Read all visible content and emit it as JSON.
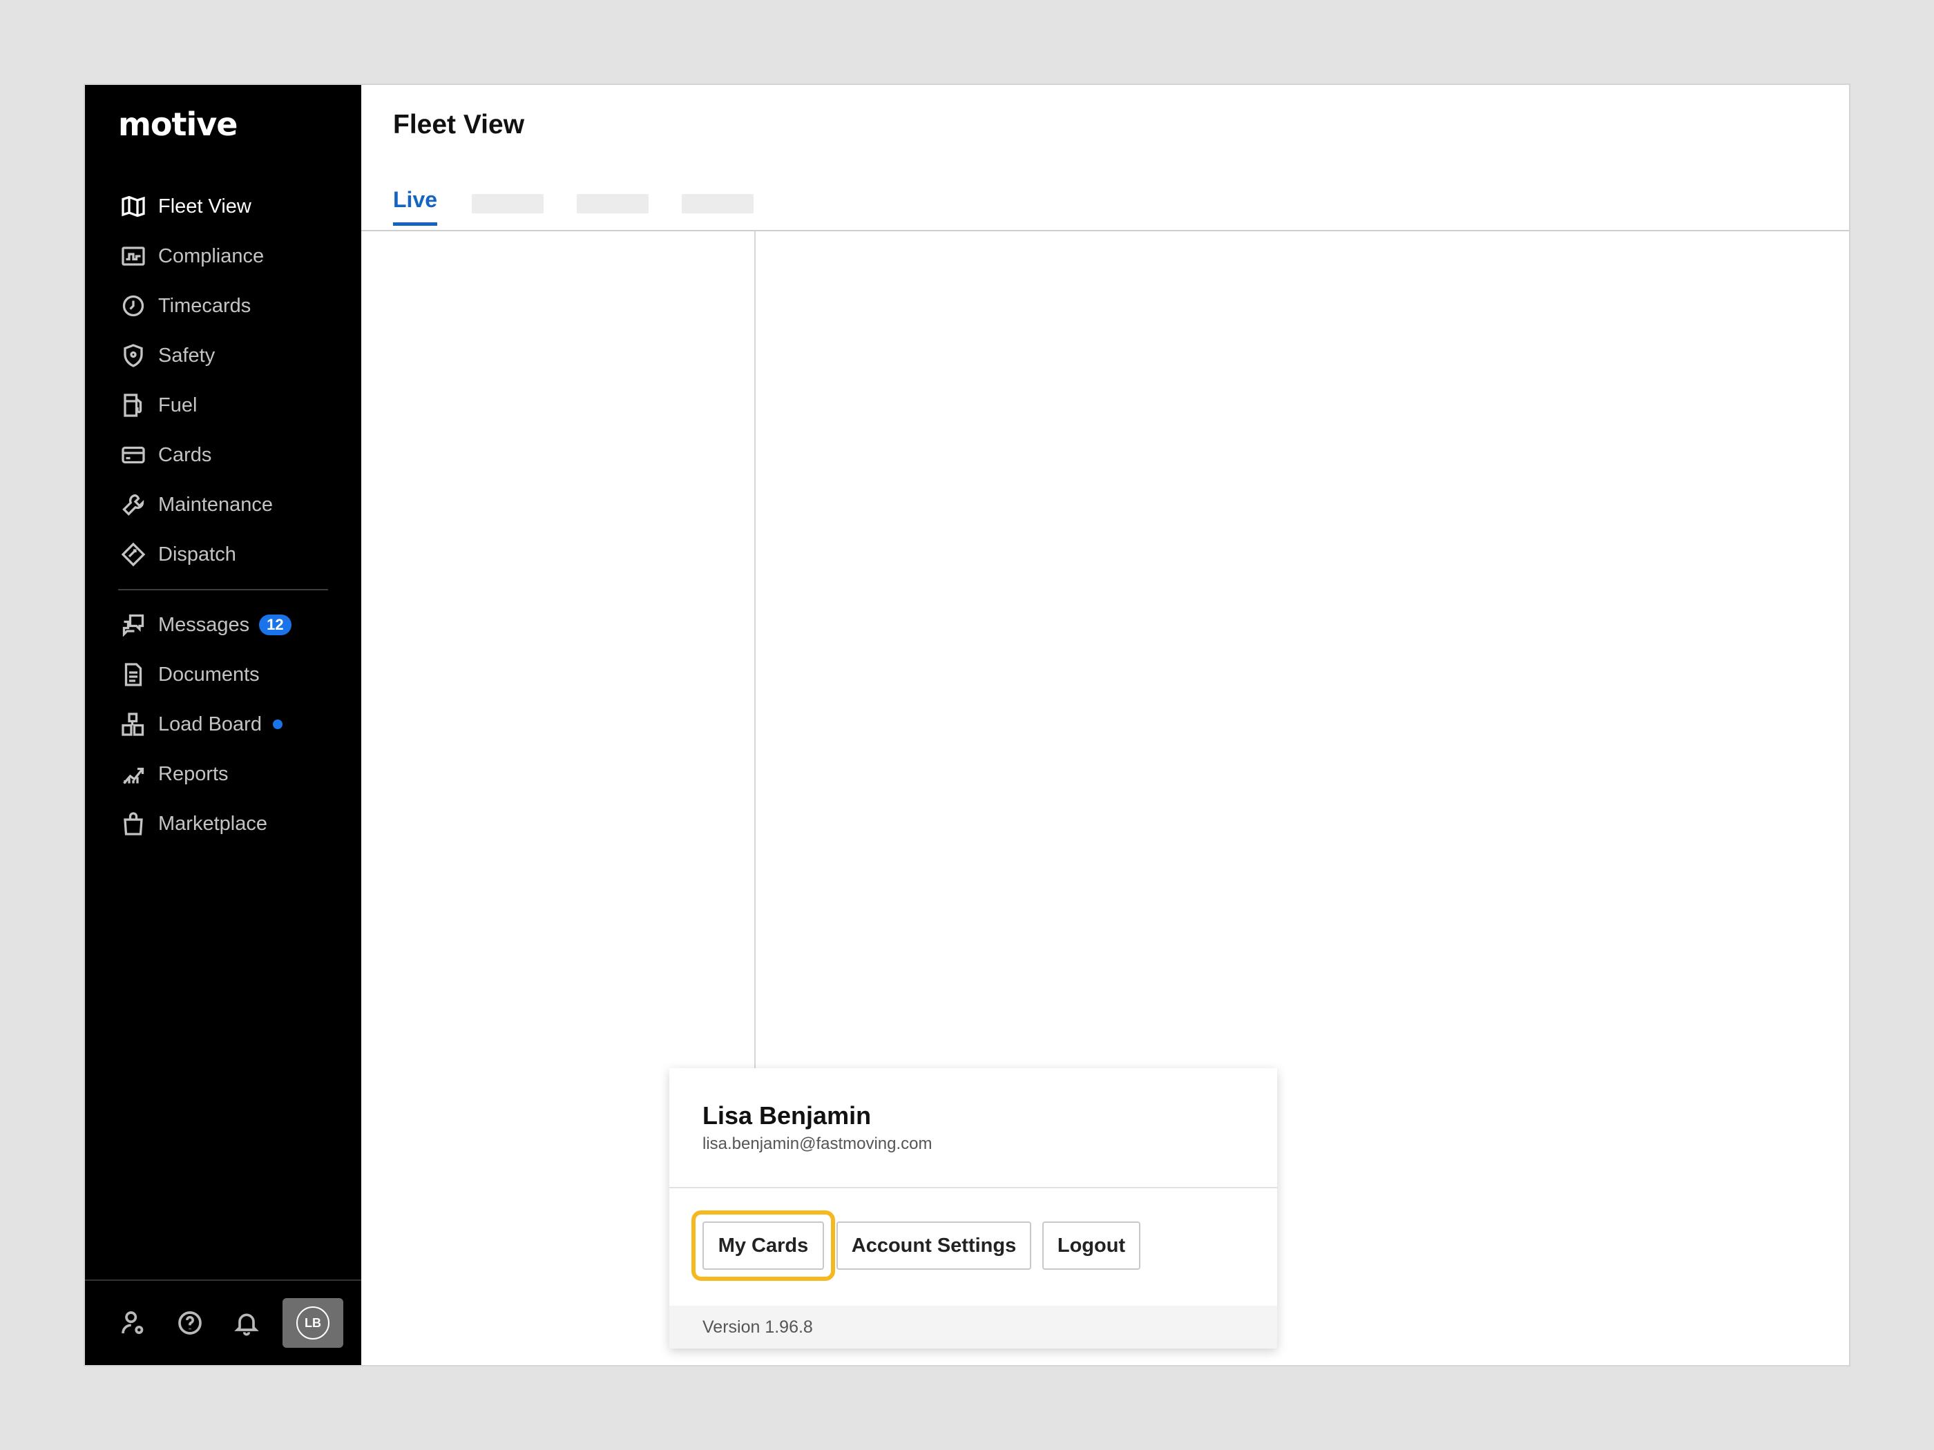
{
  "app": {
    "logo": "motive"
  },
  "sidebar": {
    "items": [
      {
        "label": "Fleet View",
        "icon": "map-icon",
        "active": true
      },
      {
        "label": "Compliance",
        "icon": "compliance-icon"
      },
      {
        "label": "Timecards",
        "icon": "clock-icon"
      },
      {
        "label": "Safety",
        "icon": "shield-icon"
      },
      {
        "label": "Fuel",
        "icon": "fuel-icon"
      },
      {
        "label": "Cards",
        "icon": "card-icon"
      },
      {
        "label": "Maintenance",
        "icon": "wrench-icon"
      },
      {
        "label": "Dispatch",
        "icon": "dispatch-icon"
      }
    ],
    "items2": [
      {
        "label": "Messages",
        "icon": "messages-icon",
        "badge": "12"
      },
      {
        "label": "Documents",
        "icon": "document-icon"
      },
      {
        "label": "Load Board",
        "icon": "load-board-icon",
        "dot": true
      },
      {
        "label": "Reports",
        "icon": "reports-icon"
      },
      {
        "label": "Marketplace",
        "icon": "shopping-bag-icon"
      }
    ],
    "footer": {
      "icons": [
        "user-settings-icon",
        "help-icon",
        "bell-icon"
      ],
      "avatar_initials": "LB"
    }
  },
  "main": {
    "title": "Fleet View",
    "tabs": [
      {
        "label": "Live",
        "active": true
      }
    ]
  },
  "popup": {
    "user_name": "Lisa Benjamin",
    "user_email": "lisa.benjamin@fastmoving.com",
    "buttons": {
      "my_cards": "My Cards",
      "account_settings": "Account Settings",
      "logout": "Logout"
    },
    "version": "Version 1.96.8"
  },
  "colors": {
    "accent": "#1565c0",
    "badge": "#1a73e8",
    "highlight": "#f5b820",
    "sidebar_bg": "#000000"
  }
}
